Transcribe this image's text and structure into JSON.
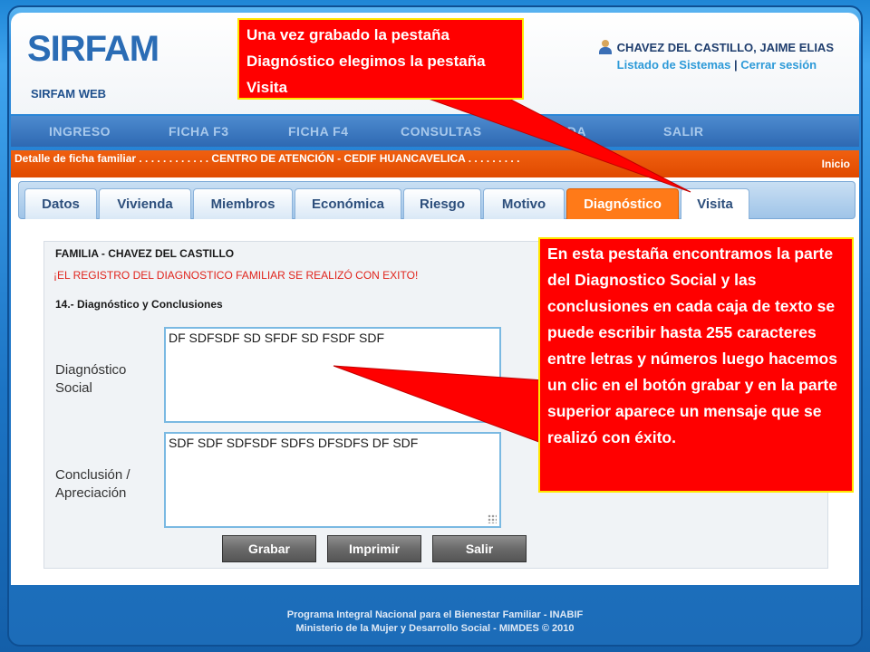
{
  "app": {
    "logo": "SIRFAM",
    "logo_sub": "SIRFAM WEB",
    "user_name": "CHAVEZ DEL CASTILLO, JAIME ELIAS",
    "link_systems": "Listado de Sistemas",
    "link_sep": "|",
    "link_logout": "Cerrar sesión"
  },
  "menu": [
    "INGRESO",
    "FICHA F3",
    "FICHA F4",
    "CONSULTAS",
    "AYUDA",
    "SALIR"
  ],
  "breadcrumb": {
    "text": "Detalle de ficha familiar . . . . . . . . . . . . CENTRO DE ATENCIÓN - CEDIF HUANCAVELICA . . . . . . . . .",
    "home": "Inicio"
  },
  "tabs": [
    "Datos",
    "Vivienda",
    "Miembros",
    "Económica",
    "Riesgo",
    "Motivo",
    "Diagnóstico",
    "Visita"
  ],
  "form": {
    "family_title": "FAMILIA - CHAVEZ DEL CASTILLO",
    "success_message": "¡EL REGISTRO DEL DIAGNOSTICO FAMILIAR SE REALIZÓ CON EXITO!",
    "section_title": "14.- Diagnóstico y Conclusiones",
    "diag_label_1": "Diagnóstico",
    "diag_label_2": "Social",
    "diag_value": "DF SDFSDF SD SFDF SD FSDF SDF",
    "concl_label_1": "Conclusión /",
    "concl_label_2": "Apreciación",
    "concl_value": "SDF SDF SDFSDF SDFS DFSDFS DF SDF",
    "btn_save": "Grabar",
    "btn_print": "Imprimir",
    "btn_exit": "Salir"
  },
  "footer": {
    "line1": "Programa Integral Nacional para el Bienestar Familiar - INABIF",
    "line2": "Ministerio de la Mujer y Desarrollo Social - MIMDES © 2010"
  },
  "callouts": {
    "top": "Una vez grabado la pestaña Diagnóstico  elegimos la pestaña Visita",
    "right": "En esta pestaña encontramos la parte del Diagnostico Social y las conclusiones en cada caja de texto se puede escribir hasta 255 caracteres  entre letras y números luego hacemos un clic en el botón grabar y en la parte superior aparece un mensaje que se realizó con éxito."
  },
  "colors": {
    "active_tab": "#ff7a18",
    "breadcrumb_bar": "#e85200",
    "callout_fill": "#ff0000",
    "callout_border": "#ffe600"
  }
}
